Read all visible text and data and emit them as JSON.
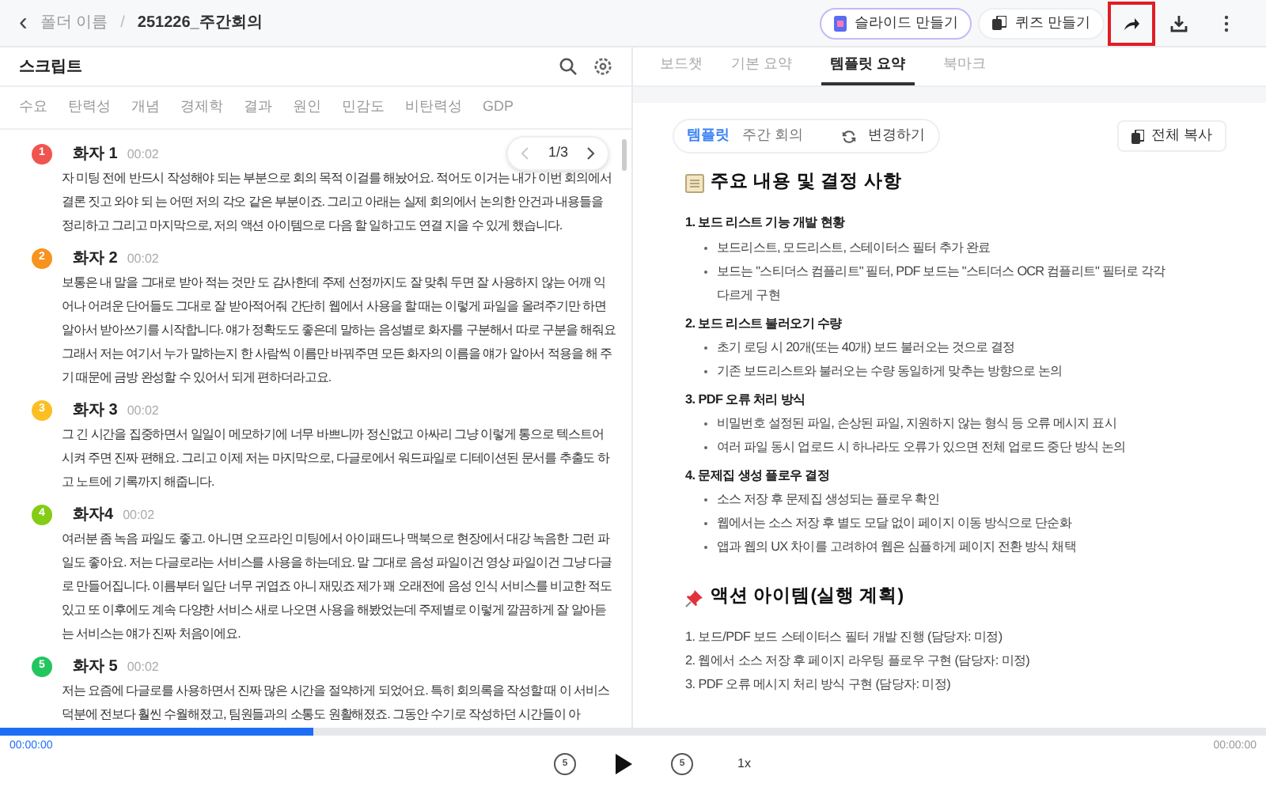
{
  "breadcrumb": {
    "back": "‹",
    "folder": "폴더 이름",
    "separator": "/",
    "title": "251226_주간회의"
  },
  "header_actions": [
    {
      "kind": "gradient",
      "label": "슬라이드 만들기",
      "highlighted": false
    },
    {
      "kind": "plain",
      "label": "퀴즈 만들기",
      "highlighted": false
    },
    {
      "kind": "share",
      "highlighted": true
    },
    {
      "kind": "download",
      "highlighted": false
    },
    {
      "kind": "more",
      "highlighted": false
    }
  ],
  "script_panel": {
    "title": "스크립트",
    "keywords": [
      "수요",
      "탄력성",
      "개념",
      "경제학",
      "결과",
      "원인",
      "민감도",
      "비탄력성",
      "GDP"
    ],
    "pager": "1/3",
    "segments": [
      {
        "speaker": "화자 1",
        "number": "1",
        "color": "#f0544f",
        "time": "00:02",
        "text": "자 미팅 전에 반드시 작성해야 되는 부분으로 회의 목적 이걸를 해놨어요. 적어도 이거는 내가 이번 회의에서 결론 짓고 와야 되 는 어떤 저의 각오 같은 부분이죠. 그리고 아래는 실제 회의에서 논의한 안건과 내용들을 정리하고 그리고 마지막으로, 저의 액션 아이템으로 다음 할 일하고도 연결 지을 수 있게 했습니다."
      },
      {
        "speaker": "화자 2",
        "number": "2",
        "color": "#f7931e",
        "time": "00:02",
        "text": "보통은 내 말을 그대로 받아 적는 것만 도 감사한데 주제 선정까지도 잘 맞춰 두면 잘 사용하지 않는 어깨 익어나 어려운 단어들도 그대로 잘 받아적어줘 간단히 웹에서 사용을 할 때는 이렇게 파일을 올려주기만 하면 알아서 받아쓰기를 시작합니다. 얘가 정확도도 좋은데 말하는 음성별로 화자를 구분해서 따로 구분을 해줘요 그래서 저는 여기서 누가 말하는지 한 사람씩 이름만 바꿔주면 모든 화자의 이름을 얘가 알아서 적용을 해 주기 때문에 금방 완성할 수 있어서 되게 편하더라고요."
      },
      {
        "speaker": "화자 3",
        "number": "3",
        "color": "#fbbf24",
        "time": "00:02",
        "text": "그 긴 시간을 집중하면서 일일이 메모하기에 너무 바쁘니까 정신없고 아싸리 그냥 이렇게 통으로 텍스트어 시켜 주면 진짜 편해요. 그리고 이제 저는 마지막으로, 다글로에서 워드파일로 디테이션된 문서를 추출도 하고 노트에 기록까지 해줍니다."
      },
      {
        "speaker": "화자4",
        "number": "4",
        "color": "#84cc16",
        "time": "00:02",
        "text": "여러분 좀 녹음 파일도 좋고. 아니면 오프라인 미팅에서 아이패드나 맥북으로 현장에서 대강 녹음한 그런 파일도 좋아요. 저는 다글로라는 서비스를 사용을 하는데요. 말 그대로 음성 파일이건 영상 파일이건 그냥 다글로 만들어집니다. 이름부터 일단 너무 귀엽죠 아니 재밌죠 제가 꽤 오래전에 음성 인식 서비스를 비교한 적도 있고 또 이후에도 계속 다양한 서비스 새로 나오면 사용을 해봤었는데 주제별로 이렇게 깔끔하게 잘 알아듣는 서비스는 얘가 진짜 처음이에요."
      },
      {
        "speaker": "화자 5",
        "number": "5",
        "color": "#22c55e",
        "time": "00:02",
        "text": "저는 요즘에 다글로를 사용하면서 진짜 많은 시간을 절약하게 되었어요. 특히 회의록을 작성할 때 이 서비스 덕분에 전보다 훨씬 수월해졌고, 팀원들과의 소통도 원활해졌죠. 그동안 수기로 작성하던 시간들이 아"
      }
    ]
  },
  "tabs": [
    {
      "label": "보드챗",
      "selected": false
    },
    {
      "label": "기본 요약",
      "selected": false
    },
    {
      "label": "템플릿 요약",
      "selected": true
    },
    {
      "label": "북마크",
      "selected": false
    }
  ],
  "template_bar": {
    "label": "템플릿",
    "name": "주간 회의",
    "change": "변경하기",
    "copy_all": "전체 복사"
  },
  "summary": [
    {
      "kind": "heading",
      "text": "주요 내용 및 결정 사항"
    },
    {
      "kind": "section",
      "text": "1. 보드 리스트 기능 개발 현황",
      "bullets": [
        "보드리스트, 모드리스트, 스테이터스 필터 추가 완료",
        "보드는 \"스티더스 컴플리트\" 필터, PDF 보드는 \"스티더스 OCR 컴플리트\" 필터로 각각 다르게 구현"
      ]
    },
    {
      "kind": "section",
      "text": "2. 보드 리스트 불러오기 수량",
      "bullets": [
        "초기 로딩 시 20개(또는 40개) 보드 불러오는 것으로 결정",
        "기존 보드리스트와 불러오는 수량 동일하게 맞추는 방향으로 논의"
      ]
    },
    {
      "kind": "section",
      "text": "3. PDF 오류 처리 방식",
      "bullets": [
        "비밀번호 설정된 파일, 손상된 파일, 지원하지 않는 형식 등 오류 메시지 표시",
        "여러 파일 동시 업로드 시 하나라도 오류가 있으면 전체 업로드 중단 방식 논의"
      ]
    },
    {
      "kind": "section",
      "text": "4. 문제집 생성 플로우 결정",
      "bullets": [
        "소스 저장 후 문제집 생성되는 플로우 확인",
        "웹에서는 소스 저장 후 별도 모달 없이 페이지 이동 방식으로 단순화",
        "앱과 웹의 UX 차이를 고려하여 웹은 심플하게 페이지 전환 방식 채택"
      ]
    },
    {
      "kind": "heading",
      "text": "액션 아이템(실행 계획)"
    },
    {
      "kind": "item",
      "text": "1. 보드/PDF 보드 스테이터스 필터 개발 진행 (담당자: 미정)"
    },
    {
      "kind": "item",
      "text": "2. 웹에서 소스 저장 후 페이지 라우팅 플로우 구현 (담당자: 미정)"
    },
    {
      "kind": "item",
      "text": "3. PDF 오류 메시지 처리 방식 구현 (담당자: 미정)"
    }
  ],
  "player": {
    "level": 0.247,
    "elapsed": "00:00:00",
    "total": "00:00:00",
    "rewind": "5",
    "forward": "5",
    "speed": "1x"
  }
}
